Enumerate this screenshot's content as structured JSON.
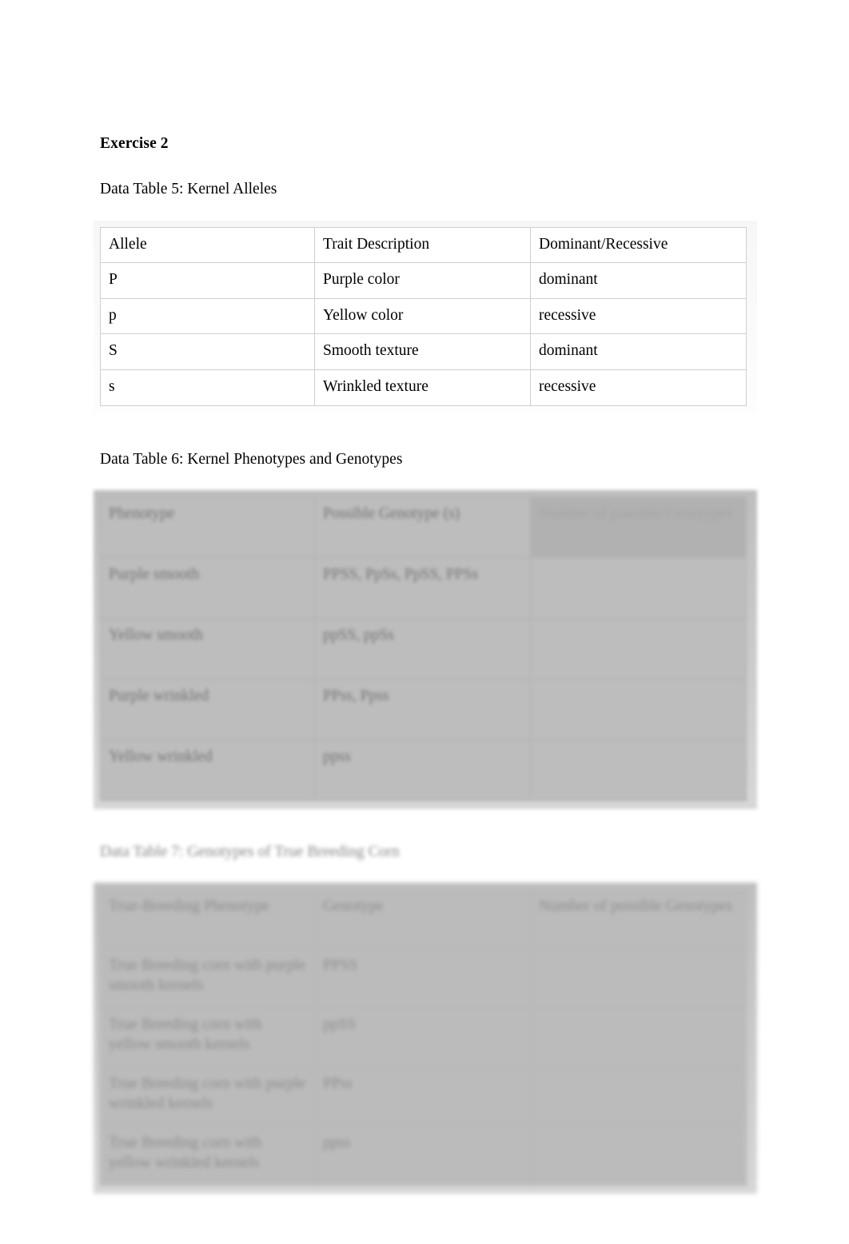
{
  "document": {
    "exercise_heading": "Exercise 2"
  },
  "table5": {
    "caption": "Data Table 5: Kernel Alleles",
    "headers": [
      "Allele",
      "Trait Description",
      "Dominant/Recessive"
    ],
    "rows": [
      [
        "P",
        "Purple color",
        "dominant"
      ],
      [
        "p",
        "Yellow color",
        "recessive"
      ],
      [
        "S",
        "Smooth texture",
        "dominant"
      ],
      [
        "s",
        "Wrinkled texture",
        "recessive"
      ]
    ]
  },
  "table6": {
    "caption": "Data Table 6: Kernel Phenotypes and Genotypes",
    "headers": [
      "Phenotype",
      "Possible Genotype (s)",
      "Number of possible Genotypes"
    ],
    "rows": [
      [
        "Purple smooth",
        "PPSS, PpSs, PpSS, PPSs",
        ""
      ],
      [
        "Yellow smooth",
        "ppSS, ppSs",
        ""
      ],
      [
        "Purple wrinkled",
        "PPss, Ppss",
        ""
      ],
      [
        "Yellow wrinkled",
        "ppss",
        ""
      ]
    ]
  },
  "table7": {
    "caption": "Data Table 7: Genotypes of True Breeding Corn",
    "headers": [
      "True-Breeding Phenotype",
      "Genotype",
      "Number of possible Genotypes"
    ],
    "rows": [
      [
        "True Breeding corn with purple smooth kernels",
        "PPSS",
        ""
      ],
      [
        "True Breeding corn with yellow smooth kernels",
        "ppSS",
        ""
      ],
      [
        "True Breeding corn with purple wrinkled kernels",
        "PPss",
        ""
      ],
      [
        "True Breeding corn with yellow wrinkled kernels",
        "ppss",
        ""
      ]
    ]
  }
}
